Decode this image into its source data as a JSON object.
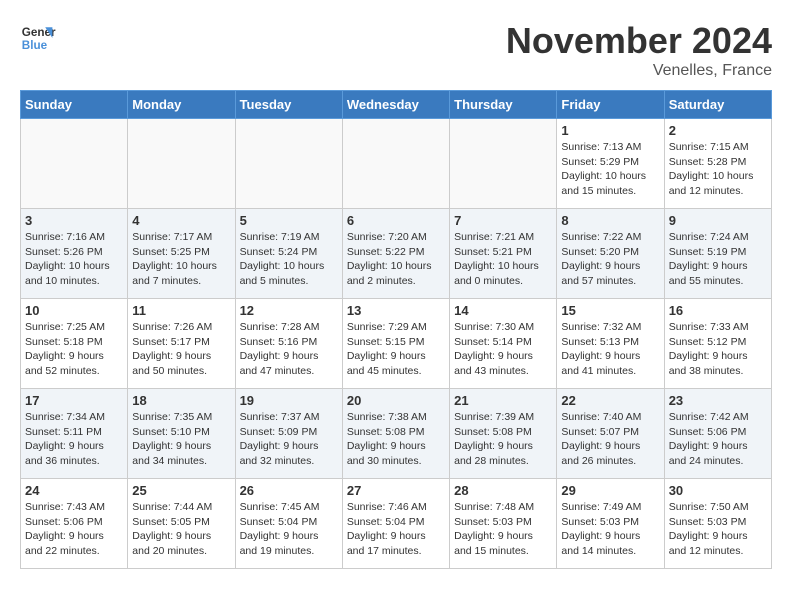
{
  "header": {
    "logo_line1": "General",
    "logo_line2": "Blue",
    "month": "November 2024",
    "location": "Venelles, France"
  },
  "columns": [
    "Sunday",
    "Monday",
    "Tuesday",
    "Wednesday",
    "Thursday",
    "Friday",
    "Saturday"
  ],
  "weeks": [
    {
      "alt": false,
      "days": [
        {
          "num": "",
          "info": ""
        },
        {
          "num": "",
          "info": ""
        },
        {
          "num": "",
          "info": ""
        },
        {
          "num": "",
          "info": ""
        },
        {
          "num": "",
          "info": ""
        },
        {
          "num": "1",
          "info": "Sunrise: 7:13 AM\nSunset: 5:29 PM\nDaylight: 10 hours\nand 15 minutes."
        },
        {
          "num": "2",
          "info": "Sunrise: 7:15 AM\nSunset: 5:28 PM\nDaylight: 10 hours\nand 12 minutes."
        }
      ]
    },
    {
      "alt": true,
      "days": [
        {
          "num": "3",
          "info": "Sunrise: 7:16 AM\nSunset: 5:26 PM\nDaylight: 10 hours\nand 10 minutes."
        },
        {
          "num": "4",
          "info": "Sunrise: 7:17 AM\nSunset: 5:25 PM\nDaylight: 10 hours\nand 7 minutes."
        },
        {
          "num": "5",
          "info": "Sunrise: 7:19 AM\nSunset: 5:24 PM\nDaylight: 10 hours\nand 5 minutes."
        },
        {
          "num": "6",
          "info": "Sunrise: 7:20 AM\nSunset: 5:22 PM\nDaylight: 10 hours\nand 2 minutes."
        },
        {
          "num": "7",
          "info": "Sunrise: 7:21 AM\nSunset: 5:21 PM\nDaylight: 10 hours\nand 0 minutes."
        },
        {
          "num": "8",
          "info": "Sunrise: 7:22 AM\nSunset: 5:20 PM\nDaylight: 9 hours\nand 57 minutes."
        },
        {
          "num": "9",
          "info": "Sunrise: 7:24 AM\nSunset: 5:19 PM\nDaylight: 9 hours\nand 55 minutes."
        }
      ]
    },
    {
      "alt": false,
      "days": [
        {
          "num": "10",
          "info": "Sunrise: 7:25 AM\nSunset: 5:18 PM\nDaylight: 9 hours\nand 52 minutes."
        },
        {
          "num": "11",
          "info": "Sunrise: 7:26 AM\nSunset: 5:17 PM\nDaylight: 9 hours\nand 50 minutes."
        },
        {
          "num": "12",
          "info": "Sunrise: 7:28 AM\nSunset: 5:16 PM\nDaylight: 9 hours\nand 47 minutes."
        },
        {
          "num": "13",
          "info": "Sunrise: 7:29 AM\nSunset: 5:15 PM\nDaylight: 9 hours\nand 45 minutes."
        },
        {
          "num": "14",
          "info": "Sunrise: 7:30 AM\nSunset: 5:14 PM\nDaylight: 9 hours\nand 43 minutes."
        },
        {
          "num": "15",
          "info": "Sunrise: 7:32 AM\nSunset: 5:13 PM\nDaylight: 9 hours\nand 41 minutes."
        },
        {
          "num": "16",
          "info": "Sunrise: 7:33 AM\nSunset: 5:12 PM\nDaylight: 9 hours\nand 38 minutes."
        }
      ]
    },
    {
      "alt": true,
      "days": [
        {
          "num": "17",
          "info": "Sunrise: 7:34 AM\nSunset: 5:11 PM\nDaylight: 9 hours\nand 36 minutes."
        },
        {
          "num": "18",
          "info": "Sunrise: 7:35 AM\nSunset: 5:10 PM\nDaylight: 9 hours\nand 34 minutes."
        },
        {
          "num": "19",
          "info": "Sunrise: 7:37 AM\nSunset: 5:09 PM\nDaylight: 9 hours\nand 32 minutes."
        },
        {
          "num": "20",
          "info": "Sunrise: 7:38 AM\nSunset: 5:08 PM\nDaylight: 9 hours\nand 30 minutes."
        },
        {
          "num": "21",
          "info": "Sunrise: 7:39 AM\nSunset: 5:08 PM\nDaylight: 9 hours\nand 28 minutes."
        },
        {
          "num": "22",
          "info": "Sunrise: 7:40 AM\nSunset: 5:07 PM\nDaylight: 9 hours\nand 26 minutes."
        },
        {
          "num": "23",
          "info": "Sunrise: 7:42 AM\nSunset: 5:06 PM\nDaylight: 9 hours\nand 24 minutes."
        }
      ]
    },
    {
      "alt": false,
      "days": [
        {
          "num": "24",
          "info": "Sunrise: 7:43 AM\nSunset: 5:06 PM\nDaylight: 9 hours\nand 22 minutes."
        },
        {
          "num": "25",
          "info": "Sunrise: 7:44 AM\nSunset: 5:05 PM\nDaylight: 9 hours\nand 20 minutes."
        },
        {
          "num": "26",
          "info": "Sunrise: 7:45 AM\nSunset: 5:04 PM\nDaylight: 9 hours\nand 19 minutes."
        },
        {
          "num": "27",
          "info": "Sunrise: 7:46 AM\nSunset: 5:04 PM\nDaylight: 9 hours\nand 17 minutes."
        },
        {
          "num": "28",
          "info": "Sunrise: 7:48 AM\nSunset: 5:03 PM\nDaylight: 9 hours\nand 15 minutes."
        },
        {
          "num": "29",
          "info": "Sunrise: 7:49 AM\nSunset: 5:03 PM\nDaylight: 9 hours\nand 14 minutes."
        },
        {
          "num": "30",
          "info": "Sunrise: 7:50 AM\nSunset: 5:03 PM\nDaylight: 9 hours\nand 12 minutes."
        }
      ]
    }
  ]
}
